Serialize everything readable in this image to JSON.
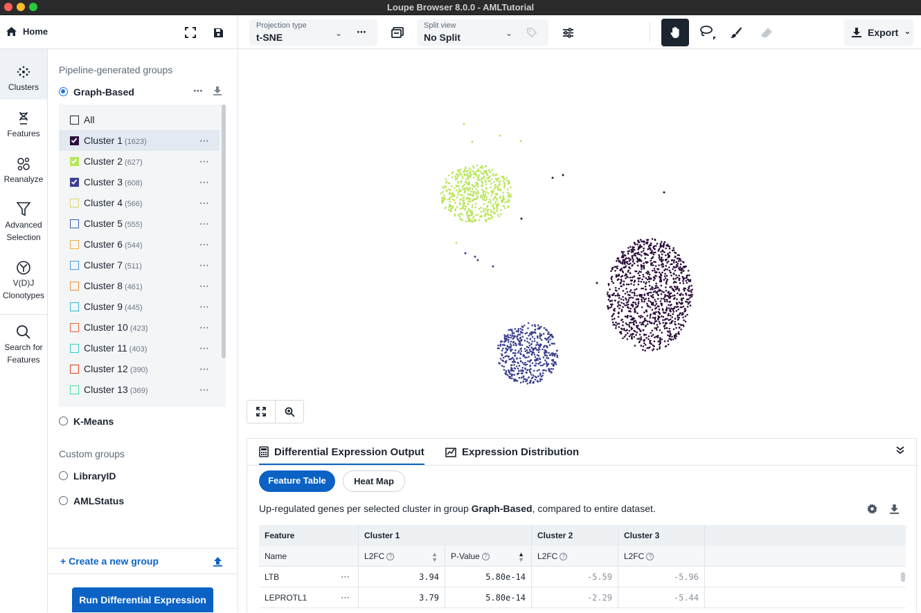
{
  "window": {
    "title": "Loupe Browser 8.0.0 - AMLTutorial"
  },
  "toolbar": {
    "home_label": "Home",
    "projection_label": "Projection type",
    "projection_value": "t-SNE",
    "split_label": "Split view",
    "split_value": "No Split",
    "export_label": "Export"
  },
  "leftnav": {
    "items": [
      {
        "label": "Clusters",
        "icon": "clusters-icon"
      },
      {
        "label": "Features",
        "icon": "dna-icon"
      },
      {
        "label": "Reanalyze",
        "icon": "reanalyze-icon"
      },
      {
        "label": "Advanced Selection",
        "icon": "filter-icon"
      },
      {
        "label": "V(D)J Clonotypes",
        "icon": "antibody-icon"
      },
      {
        "label": "Search for Features",
        "icon": "search-icon"
      }
    ]
  },
  "panel": {
    "pipeline_title": "Pipeline-generated groups",
    "graph_based": "Graph-Based",
    "all_label": "All",
    "clusters": [
      {
        "name": "Cluster 1",
        "count": "(1623)",
        "color": "#2b0f3a",
        "checked": true
      },
      {
        "name": "Cluster 2",
        "count": "(627)",
        "color": "#b9e55a",
        "checked": true
      },
      {
        "name": "Cluster 3",
        "count": "(608)",
        "color": "#3a3f8f",
        "checked": true
      },
      {
        "name": "Cluster 4",
        "count": "(566)",
        "color": "#e0d66a",
        "checked": false
      },
      {
        "name": "Cluster 5",
        "count": "(555)",
        "color": "#3b5fb0",
        "checked": false
      },
      {
        "name": "Cluster 6",
        "count": "(544)",
        "color": "#f0b040",
        "checked": false
      },
      {
        "name": "Cluster 7",
        "count": "(511)",
        "color": "#4a9be0",
        "checked": false
      },
      {
        "name": "Cluster 8",
        "count": "(461)",
        "color": "#f09030",
        "checked": false
      },
      {
        "name": "Cluster 9",
        "count": "(445)",
        "color": "#30b8d8",
        "checked": false
      },
      {
        "name": "Cluster 10",
        "count": "(423)",
        "color": "#e06030",
        "checked": false
      },
      {
        "name": "Cluster 11",
        "count": "(403)",
        "color": "#30d0c0",
        "checked": false
      },
      {
        "name": "Cluster 12",
        "count": "(390)",
        "color": "#d84020",
        "checked": false
      },
      {
        "name": "Cluster 13",
        "count": "(369)",
        "color": "#40e0a0",
        "checked": false
      }
    ],
    "kmeans": "K-Means",
    "custom_title": "Custom groups",
    "library_id": "LibraryID",
    "aml_status": "AMLStatus",
    "create_group": "Create a new group",
    "run_de": "Run Differential Expression"
  },
  "de": {
    "tab_output": "Differential Expression Output",
    "tab_distribution": "Expression Distribution",
    "pill_feature_table": "Feature Table",
    "pill_heat_map": "Heat Map",
    "desc_prefix": "Up-regulated genes per selected cluster in group ",
    "desc_group": "Graph-Based",
    "desc_suffix": ", compared to entire dataset.",
    "col_feature": "Feature",
    "col_cluster1": "Cluster 1",
    "col_cluster2": "Cluster 2",
    "col_cluster3": "Cluster 3",
    "sub_name": "Name",
    "sub_l2fc": "L2FC",
    "sub_pvalue": "P-Value",
    "rows": [
      {
        "name": "LTB",
        "c1_l2fc": "3.94",
        "c1_p": "5.80e-14",
        "c2_l2fc": "-5.59",
        "c3_l2fc": "-5.96"
      },
      {
        "name": "LEPROTL1",
        "c1_l2fc": "3.79",
        "c1_p": "5.80e-14",
        "c2_l2fc": "-2.29",
        "c3_l2fc": "-5.44"
      }
    ]
  }
}
